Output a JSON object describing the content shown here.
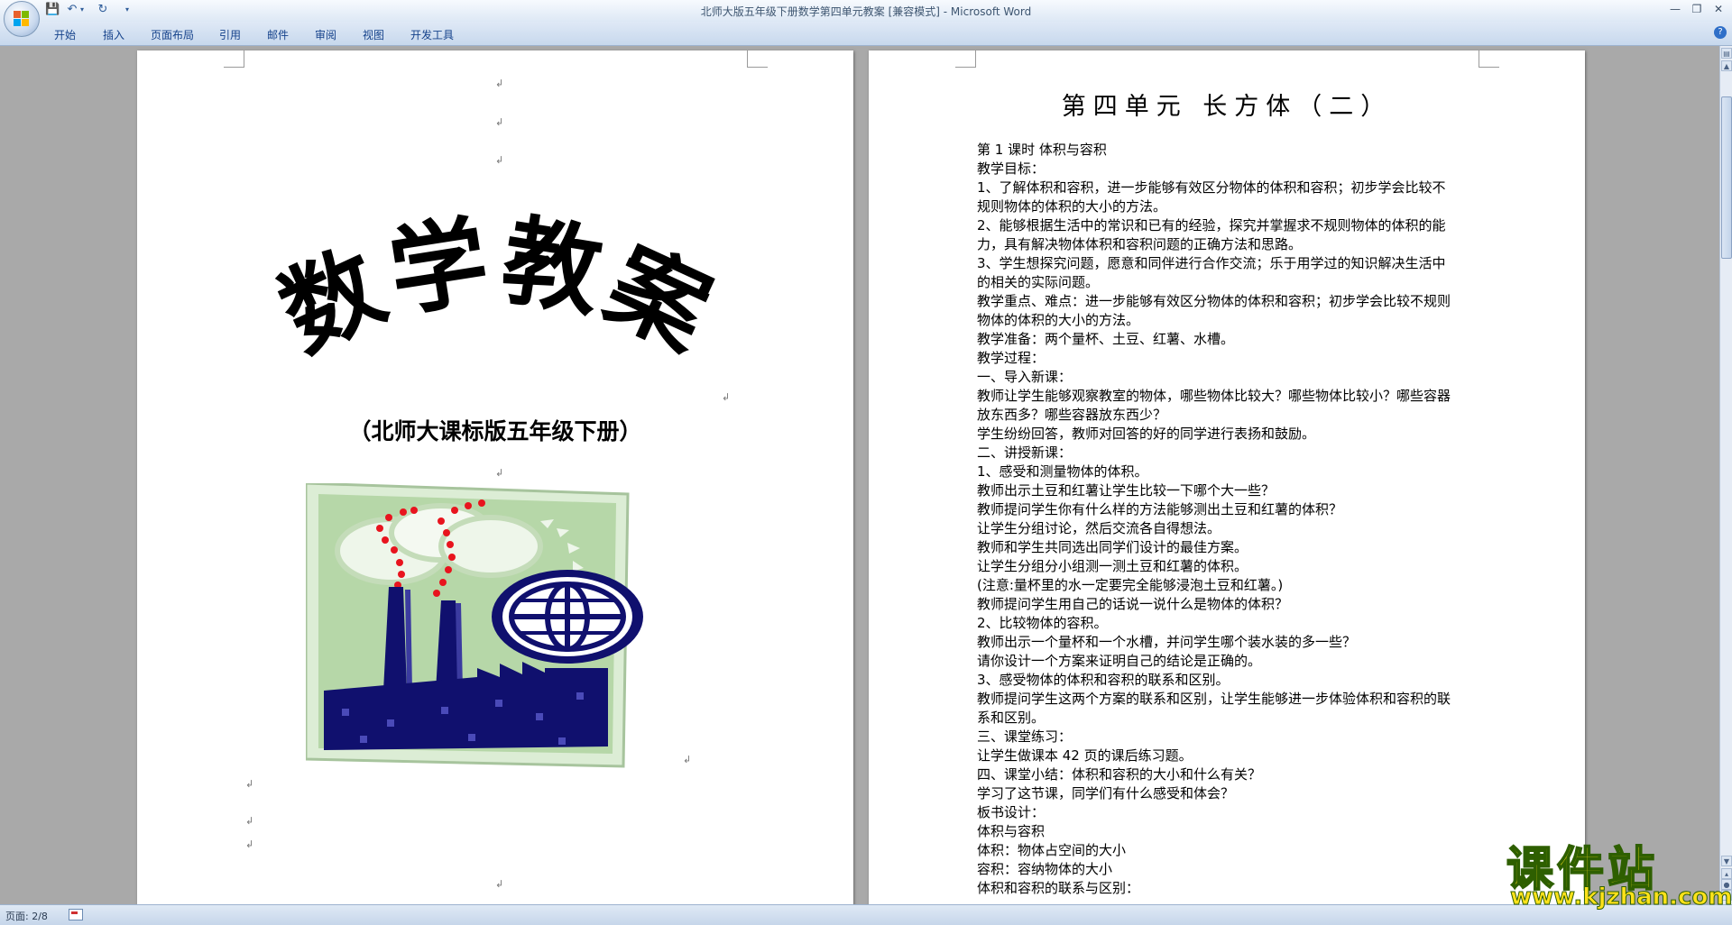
{
  "window": {
    "title": "北师大版五年级下册数学第四单元教案 [兼容模式] - Microsoft Word"
  },
  "ribbon": {
    "tabs": [
      "开始",
      "插入",
      "页面布局",
      "引用",
      "邮件",
      "审阅",
      "视图",
      "开发工具"
    ]
  },
  "cover": {
    "wordart": "数学教案",
    "subtitle": "（北师大课标版五年级下册）"
  },
  "document": {
    "heading": "第四单元    长方体（二）",
    "lines": [
      "第 1 课时   体积与容积",
      "教学目标：",
      "1、了解体积和容积，进一步能够有效区分物体的体积和容积；初步学会比较不",
      "规则物体的体积的大小的方法。",
      "2、能够根据生活中的常识和已有的经验，探究并掌握求不规则物体的体积的能",
      "力，具有解决物体体积和容积问题的正确方法和思路。",
      "3、学生想探究问题，愿意和同伴进行合作交流；乐于用学过的知识解决生活中",
      "的相关的实际问题。",
      "教学重点、难点：进一步能够有效区分物体的体积和容积；初步学会比较不规则",
      "物体的体积的大小的方法。",
      "教学准备：两个量杯、土豆、红薯、水槽。",
      "教学过程：",
      "一、导入新课：",
      "教师让学生能够观察教室的物体，哪些物体比较大？哪些物体比较小？哪些容器",
      "放东西多？哪些容器放东西少？",
      "学生纷纷回答，教师对回答的好的同学进行表扬和鼓励。",
      "二、讲授新课：",
      "1、感受和测量物体的体积。",
      "教师出示土豆和红薯让学生比较一下哪个大一些？",
      "教师提问学生你有什么样的方法能够测出土豆和红薯的体积？",
      "让学生分组讨论，然后交流各自得想法。",
      "教师和学生共同选出同学们设计的最佳方案。",
      "让学生分组分小组测一测土豆和红薯的体积。",
      "(注意:量杯里的水一定要完全能够浸泡土豆和红薯。)",
      "教师提问学生用自己的话说一说什么是物体的体积？",
      "2、比较物体的容积。",
      "教师出示一个量杯和一个水槽，并问学生哪个装水装的多一些？",
      "请你设计一个方案来证明自己的结论是正确的。",
      "3、感受物体的体积和容积的联系和区别。",
      "教师提问学生这两个方案的联系和区别，让学生能够进一步体验体积和容积的联",
      "系和区别。",
      "三、课堂练习：",
      "让学生做课本 42 页的课后练习题。",
      "四、课堂小结：体积和容积的大小和什么有关？",
      "学习了这节课，同学们有什么感受和体会？",
      "板书设计：",
      "体积与容积",
      "体积：物体占空间的大小",
      "容积：容纳物体的大小",
      "体积和容积的联系与区别："
    ]
  },
  "status": {
    "page": "页面: 2/8"
  },
  "watermark": {
    "title": "课件站",
    "url": "www.kjzhan.com"
  },
  "colors": {
    "ribbon": "#c7d8ed",
    "factory": "#10106e",
    "smoke_dots": "#e8141e",
    "watermark": "#ffe21a"
  }
}
